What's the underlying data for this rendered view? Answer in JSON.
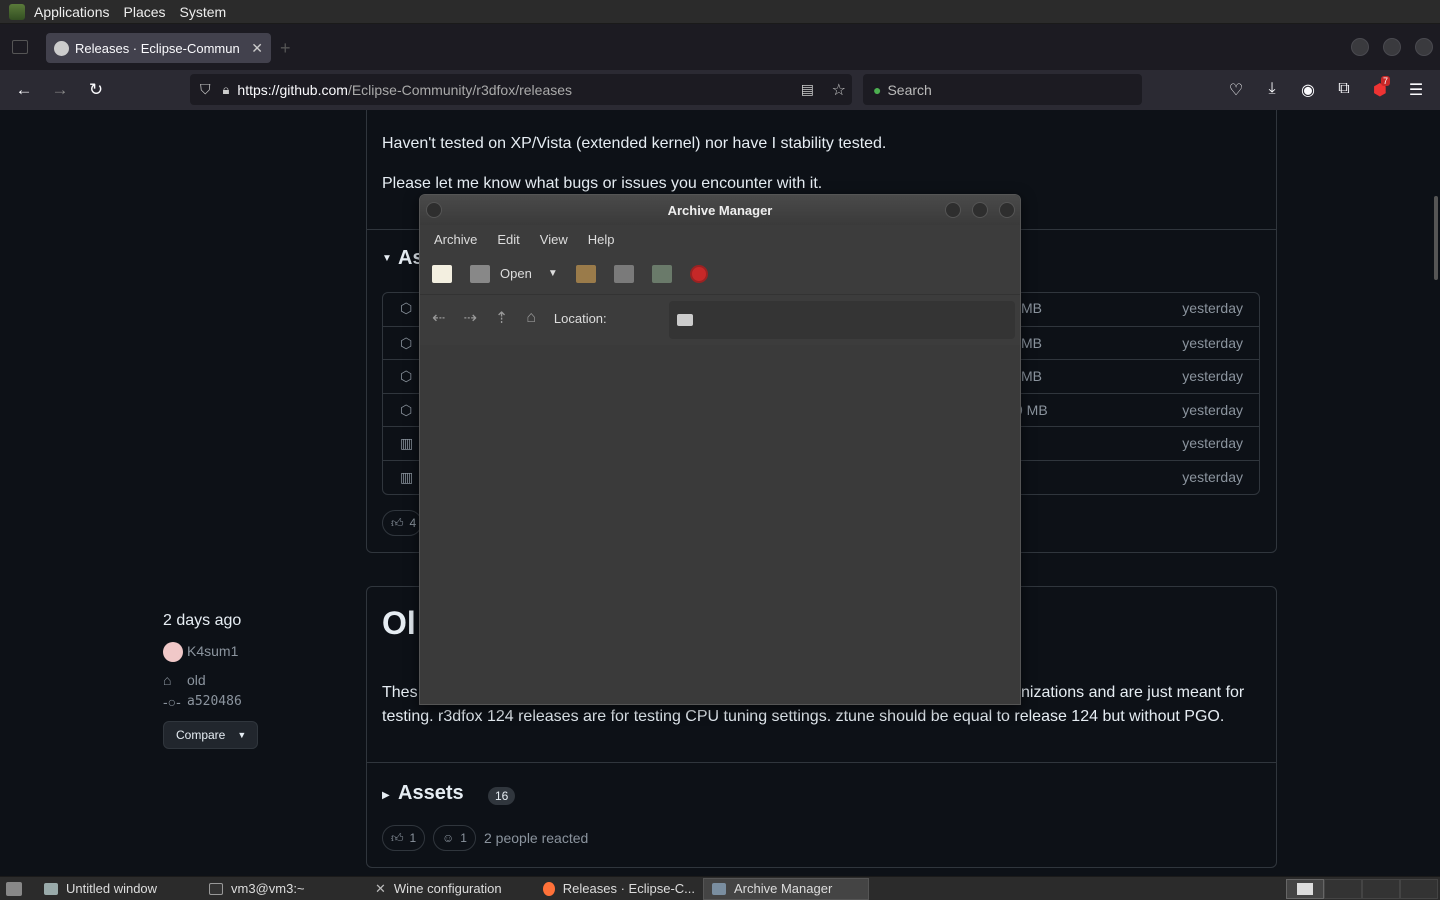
{
  "top_panel": {
    "menus": [
      "Applications",
      "Places",
      "System"
    ]
  },
  "browser": {
    "tab_title": "Releases · Eclipse-Commun",
    "url_host": "https://github.com",
    "url_path": "/Eclipse-Community/r3dfox/releases",
    "search_placeholder": "Search",
    "notification_count": "7"
  },
  "page": {
    "text_line1": "Haven't tested on XP/Vista (extended kernel) nor have I stability tested.",
    "text_line2": "Please let me know what bugs or issues you encounter with it.",
    "assets_heading_partial": "As",
    "asset_rows": [
      {
        "size": "MB",
        "date": "yesterday"
      },
      {
        "size": "MB",
        "date": "yesterday"
      },
      {
        "size": "MB",
        "date": "yesterday"
      },
      {
        "size": "9 MB",
        "date": "yesterday"
      },
      {
        "size": "",
        "date": "yesterday"
      },
      {
        "size": "",
        "date": "yesterday"
      }
    ],
    "reaction1_count": "4",
    "release2": {
      "heading_partial": "Ol",
      "time": "2 days ago",
      "author": "K4sum1",
      "tag": "old",
      "commit": "a520486",
      "compare_label": "Compare",
      "body_prefix": "Thes",
      "body_suffix": "nizations and are just meant for",
      "body_line2": "testing. r3dfox 124 releases are for testing CPU tuning settings. ztune should be equal to release 124 but without PGO.",
      "assets_label": "Assets",
      "assets_count": "16",
      "thumbs_count": "1",
      "smile_count": "1",
      "reacted_text": "2 people reacted"
    }
  },
  "archive_manager": {
    "title": "Archive Manager",
    "menus": [
      "Archive",
      "Edit",
      "View",
      "Help"
    ],
    "open_label": "Open",
    "location_label": "Location:"
  },
  "taskbar": {
    "items": [
      "Untitled window",
      "vm3@vm3:~",
      "Wine configuration",
      "Releases · Eclipse-C...",
      "Archive Manager"
    ]
  }
}
